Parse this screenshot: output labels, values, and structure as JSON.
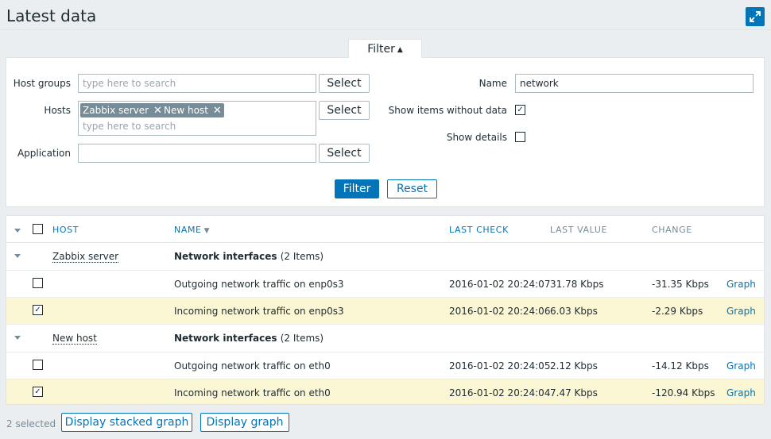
{
  "header": {
    "title": "Latest data",
    "fullscreen_icon": "expand-icon"
  },
  "filter_tab": {
    "label": "Filter"
  },
  "filter": {
    "host_groups": {
      "label": "Host groups",
      "placeholder": "type here to search",
      "select_label": "Select"
    },
    "hosts": {
      "label": "Hosts",
      "chips": [
        "Zabbix server",
        "New host"
      ],
      "placeholder": "type here to search",
      "select_label": "Select"
    },
    "application": {
      "label": "Application",
      "value": "",
      "select_label": "Select"
    },
    "name": {
      "label": "Name",
      "value": "network"
    },
    "show_without_data": {
      "label": "Show items without data",
      "checked": true
    },
    "show_details": {
      "label": "Show details",
      "checked": false
    },
    "filter_button": "Filter",
    "reset_button": "Reset"
  },
  "table": {
    "columns": {
      "host": "HOST",
      "name": "NAME",
      "last_check": "LAST CHECK",
      "last_value": "LAST VALUE",
      "change": "CHANGE"
    },
    "groups": [
      {
        "host": "Zabbix server",
        "app": "Network interfaces",
        "count": "(2 Items)",
        "items": [
          {
            "name": "Outgoing network traffic on enp0s3",
            "last_check": "2016-01-02 20:24:07",
            "last_value": "31.78 Kbps",
            "change": "-31.35 Kbps",
            "link": "Graph",
            "checked": false
          },
          {
            "name": "Incoming network traffic on enp0s3",
            "last_check": "2016-01-02 20:24:06",
            "last_value": "6.03 Kbps",
            "change": "-2.29 Kbps",
            "link": "Graph",
            "checked": true
          }
        ]
      },
      {
        "host": "New host",
        "app": "Network interfaces",
        "count": "(2 Items)",
        "items": [
          {
            "name": "Outgoing network traffic on eth0",
            "last_check": "2016-01-02 20:24:05",
            "last_value": "2.12 Kbps",
            "change": "-14.12 Kbps",
            "link": "Graph",
            "checked": false
          },
          {
            "name": "Incoming network traffic on eth0",
            "last_check": "2016-01-02 20:24:04",
            "last_value": "7.47 Kbps",
            "change": "-120.94 Kbps",
            "link": "Graph",
            "checked": true
          }
        ]
      }
    ]
  },
  "footer": {
    "selected_count": "2 selected",
    "stacked_graph": "Display stacked graph",
    "graph": "Display graph"
  },
  "colors": {
    "accent": "#0275b8",
    "highlight": "#fbf6d3",
    "chip": "#768d99"
  }
}
